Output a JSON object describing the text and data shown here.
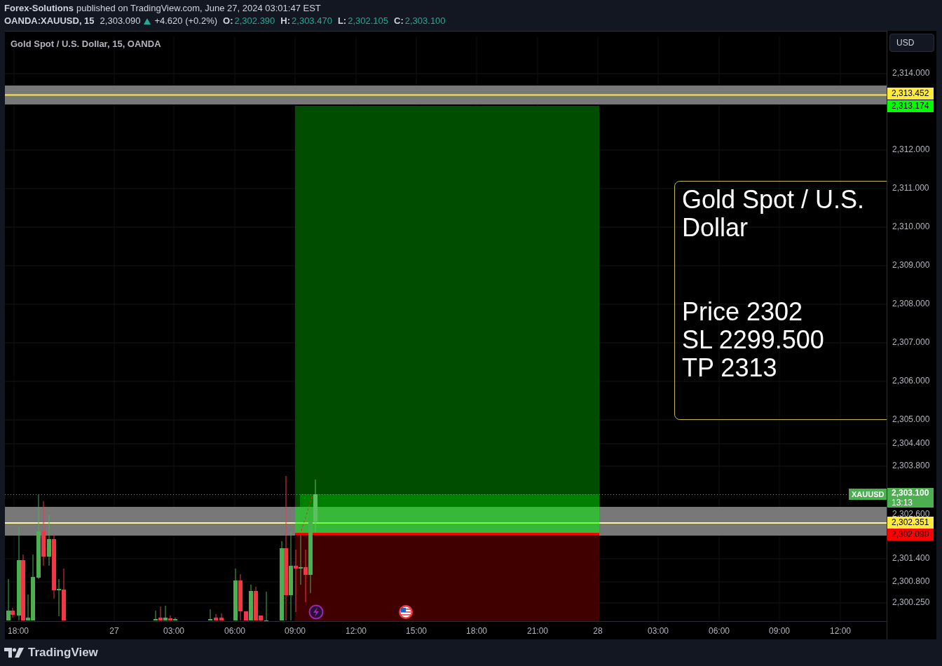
{
  "header": {
    "author": "Forex-Solutions",
    "published": "published on TradingView.com, June 27, 2024 03:01:47 EST"
  },
  "symbol_bar": {
    "symbol": "OANDA:XAUUSD, 15",
    "last": "2,303.090",
    "change": "+4.620 (+0.2%)",
    "up": true,
    "ohlc": [
      {
        "label": "O:",
        "value": "2,302.390"
      },
      {
        "label": "H:",
        "value": "2,303.470"
      },
      {
        "label": "L:",
        "value": "2,302.105"
      },
      {
        "label": "C:",
        "value": "2,303.100"
      }
    ]
  },
  "chart": {
    "legend": "Gold Spot / U.S. Dollar, 15, OANDA",
    "note": {
      "title": "Gold Spot / U.S. Dollar",
      "lines": [
        "Price 2302",
        "SL 2299.500",
        "TP 2313"
      ]
    },
    "symbol_tag": "XAUUSD"
  },
  "price_axis": {
    "currency": "USD",
    "ticks": [
      "2,314.000",
      "2,312.000",
      "2,311.000",
      "2,310.000",
      "2,309.000",
      "2,308.000",
      "2,307.000",
      "2,306.000",
      "2,305.000",
      "2,304.400",
      "2,303.800",
      "2,302.600",
      "2,301.400",
      "2,300.800",
      "2,300.250"
    ],
    "labels": [
      {
        "text": "2,313.452",
        "color": "#ffeb3b"
      },
      {
        "text": "2,313.174",
        "color": "#00ff00"
      },
      {
        "text": "2,302.351",
        "color": "#ffeb3b"
      },
      {
        "text": "2,302.090",
        "color": "#ff0000"
      }
    ],
    "last": {
      "price": "2,303.100",
      "countdown": "13:13",
      "color": "#4caf50"
    }
  },
  "time_axis": [
    "18:00",
    "27",
    "03:00",
    "06:00",
    "09:00",
    "12:00",
    "15:00",
    "18:00",
    "21:00",
    "28",
    "03:00",
    "06:00",
    "09:00",
    "12:00"
  ],
  "footer": {
    "brand": "TradingView"
  }
}
